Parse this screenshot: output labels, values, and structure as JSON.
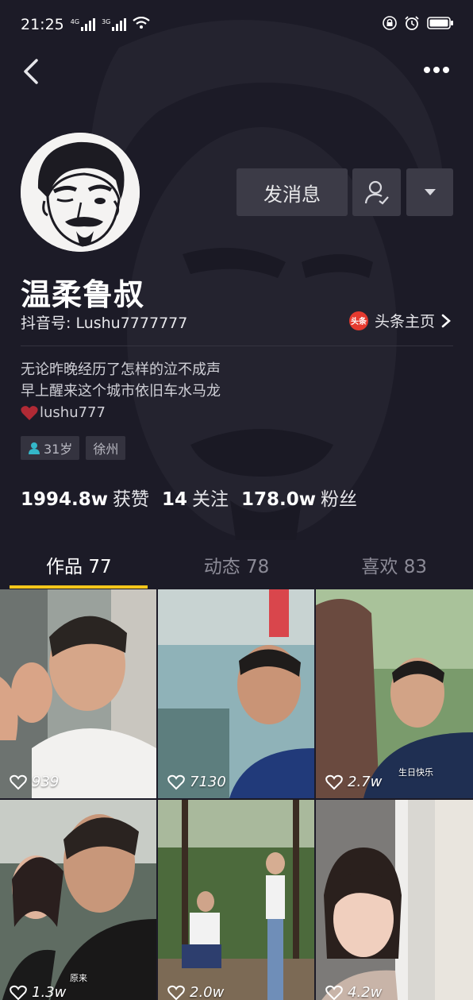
{
  "status_bar": {
    "time": "21:25",
    "network_1": "4G",
    "network_2": "3G",
    "icons": [
      "signal-icon",
      "wifi-icon",
      "lock-icon",
      "alarm-icon",
      "battery-icon"
    ]
  },
  "profile": {
    "name": "温柔鲁叔",
    "douyin_id": "抖音号: Lushu7777777",
    "toutiao_label": "头条主页",
    "toutiao_badge": "头条",
    "bio": [
      "无论昨晚经历了怎样的泣不成声",
      "早上醒来这个城市依旧车水马龙",
      "lushu777"
    ],
    "tags": [
      "31岁",
      "徐州"
    ]
  },
  "actions": {
    "message_label": "发消息"
  },
  "stats": [
    {
      "value": "1994.8w",
      "label": "获赞"
    },
    {
      "value": "14",
      "label": "关注"
    },
    {
      "value": "178.0w",
      "label": "粉丝"
    }
  ],
  "tabs": [
    {
      "label": "作品 77",
      "active": true
    },
    {
      "label": "动态 78",
      "active": false
    },
    {
      "label": "喜欢 83",
      "active": false
    }
  ],
  "videos": [
    {
      "likes": "939"
    },
    {
      "likes": "7130"
    },
    {
      "likes": "2.7w",
      "caption": "生日快乐"
    },
    {
      "likes": "1.3w",
      "caption": "原来"
    },
    {
      "likes": "2.0w"
    },
    {
      "likes": "4.2w"
    }
  ],
  "colors": {
    "background": "#1c1b27",
    "button": "#3c3b47",
    "accent_tab": "#f7c71b",
    "toutiao_red": "#e53a2f"
  }
}
